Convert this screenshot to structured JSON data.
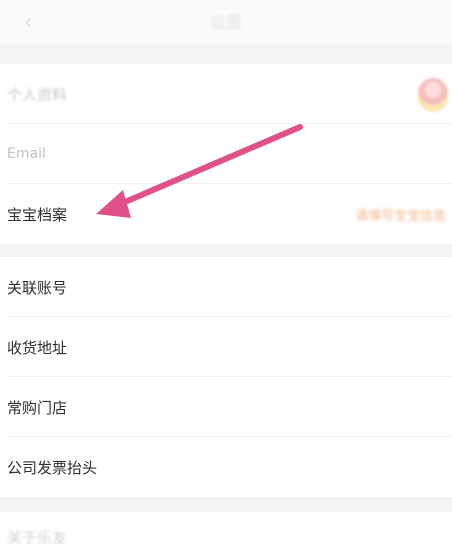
{
  "header": {
    "back_icon": "chevron-left-icon",
    "title": "设置"
  },
  "profile": {
    "personal_info_label": "个人资料",
    "email_label": "Email",
    "baby_profile_label": "宝宝档案",
    "baby_profile_hint": "请填写宝宝信息",
    "avatar_icon": "avatar-image"
  },
  "settings": {
    "items": [
      {
        "label": "关联账号"
      },
      {
        "label": "收货地址"
      },
      {
        "label": "常购门店"
      },
      {
        "label": "公司发票抬头"
      }
    ]
  },
  "footer": {
    "partial_label": "关于乐友"
  },
  "annotation": {
    "arrow_color": "#e0518a"
  }
}
